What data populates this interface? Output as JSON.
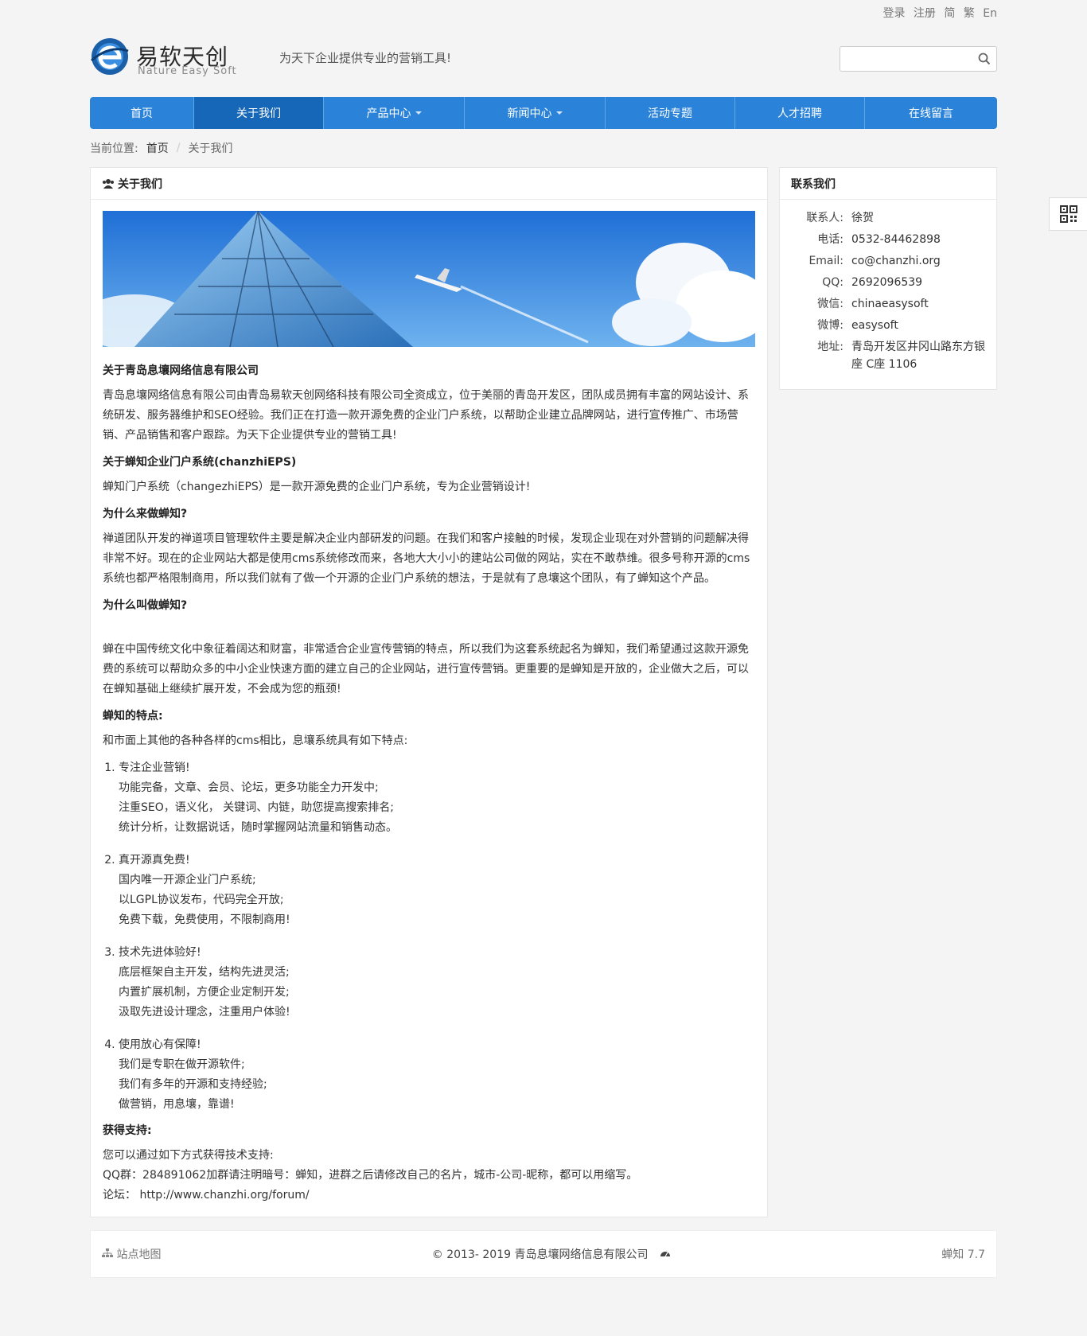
{
  "topbar": {
    "links": [
      "登录",
      "注册",
      "简",
      "繁",
      "En"
    ]
  },
  "logo": {
    "cn": "易软天创",
    "en": "Nature Easy Soft"
  },
  "slogan": "为天下企业提供专业的营销工具!",
  "search": {
    "placeholder": ""
  },
  "nav": [
    {
      "label": "首页"
    },
    {
      "label": "关于我们"
    },
    {
      "label": "产品中心"
    },
    {
      "label": "新闻中心"
    },
    {
      "label": "活动专题"
    },
    {
      "label": "人才招聘"
    },
    {
      "label": "在线留言"
    }
  ],
  "breadcrumb": {
    "prefix": "当前位置:",
    "home": "首页",
    "current": "关于我们"
  },
  "content": {
    "title": "关于我们",
    "sections": [
      {
        "heading": "关于青岛息壤网络信息有限公司",
        "text": "青岛息壤网络信息有限公司由青岛易软天创网络科技有限公司全资成立，位于美丽的青岛开发区，团队成员拥有丰富的网站设计、系统研发、服务器维护和SEO经验。我们正在打造一款开源免费的企业门户系统，以帮助企业建立品牌网站，进行宣传推广、市场营销、产品销售和客户跟踪。为天下企业提供专业的营销工具!"
      },
      {
        "heading": "关于蝉知企业门户系统(chanzhiEPS)",
        "text": "蝉知门户系统（changezhiEPS）是一款开源免费的企业门户系统，专为企业营销设计!"
      },
      {
        "heading": "为什么来做蝉知?",
        "text": "禅道团队开发的禅道项目管理软件主要是解决企业内部研发的问题。在我们和客户接触的时候，发现企业现在对外营销的问题解决得非常不好。现在的企业网站大都是使用cms系统修改而来，各地大大小小的建站公司做的网站，实在不敢恭维。很多号称开源的cms系统也都严格限制商用，所以我们就有了做一个开源的企业门户系统的想法，于是就有了息壤这个团队，有了蝉知这个产品。"
      },
      {
        "heading": "为什么叫做蝉知?",
        "text": "蝉在中国传统文化中象征着阔达和财富，非常适合企业宣传营销的特点，所以我们为这套系统起名为蝉知，我们希望通过这款开源免费的系统可以帮助众多的中小企业快速方面的建立自己的企业网站，进行宣传营销。更重要的是蝉知是开放的，企业做大之后，可以在蝉知基础上继续扩展开发，不会成为您的瓶颈!"
      }
    ],
    "features_heading": "蝉知的特点:",
    "features_intro": "和市面上其他的各种各样的cms相比，息壤系统具有如下特点:",
    "features": [
      {
        "title": "专注企业营销!",
        "lines": [
          "功能完备，文章、会员、论坛，更多功能全力开发中;",
          "注重SEO，语义化， 关键词、内链，助您提高搜索排名;",
          "统计分析，让数据说话，随时掌握网站流量和销售动态。"
        ]
      },
      {
        "title": "真开源真免费!",
        "lines": [
          "国内唯一开源企业门户系统;",
          "以LGPL协议发布，代码完全开放;",
          "免费下载，免费使用，不限制商用!"
        ]
      },
      {
        "title": "技术先进体验好!",
        "lines": [
          "底层框架自主开发，结构先进灵活;",
          "内置扩展机制，方便企业定制开发;",
          "汲取先进设计理念，注重用户体验!"
        ]
      },
      {
        "title": "使用放心有保障!",
        "lines": [
          "我们是专职在做开源软件;",
          "我们有多年的开源和支持经验;",
          "做营销，用息壤，靠谱!"
        ]
      }
    ],
    "support_heading": "获得支持:",
    "support_lines": [
      "您可以通过如下方式获得技术支持:",
      "QQ群：284891062加群请注明暗号：蝉知，进群之后请修改自己的名片，城市-公司-昵称，都可以用缩写。",
      "论坛： http://www.chanzhi.org/forum/"
    ]
  },
  "sidebar": {
    "title": "联系我们",
    "rows": [
      {
        "label": "联系人:",
        "value": "徐贺"
      },
      {
        "label": "电话:",
        "value": "0532-84462898"
      },
      {
        "label": "Email:",
        "value": "co@chanzhi.org"
      },
      {
        "label": "QQ:",
        "value": "2692096539"
      },
      {
        "label": "微信:",
        "value": "chinaeasysoft"
      },
      {
        "label": "微博:",
        "value": "easysoft"
      },
      {
        "label": "地址:",
        "value": "青岛开发区井冈山路东方银座 C座 1106"
      }
    ]
  },
  "footer": {
    "sitemap": "站点地图",
    "copyright": "© 2013- 2019 青岛息壤网络信息有限公司",
    "powered": "蝉知 7.7"
  },
  "colors": {
    "nav": "#2a83d8",
    "nav_active": "#1667b7"
  }
}
